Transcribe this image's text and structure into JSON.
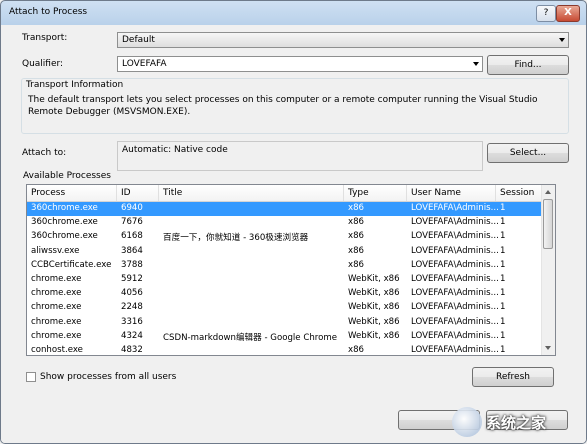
{
  "window": {
    "title": "Attach to Process",
    "help_label": "?",
    "close_label": "X"
  },
  "transport": {
    "label": "Transport:",
    "value": "Default"
  },
  "qualifier": {
    "label": "Qualifier:",
    "value": "LOVEFAFA",
    "find_button": "Find..."
  },
  "transport_info": {
    "label": "Transport Information",
    "text": "The default transport lets you select processes on this computer or a remote computer running the Visual Studio Remote Debugger (MSVSMON.EXE)."
  },
  "attach_to": {
    "label": "Attach to:",
    "value": "Automatic: Native code",
    "select_button": "Select..."
  },
  "available": {
    "label": "Available Processes",
    "columns": [
      "Process",
      "ID",
      "Title",
      "Type",
      "User Name",
      "Session"
    ],
    "rows": [
      {
        "process": "360chrome.exe",
        "id": "6940",
        "title": "",
        "type": "x86",
        "user": "LOVEFAFA\\Adminis...",
        "session": "1"
      },
      {
        "process": "360chrome.exe",
        "id": "7676",
        "title": "",
        "type": "x86",
        "user": "LOVEFAFA\\Adminis...",
        "session": "1"
      },
      {
        "process": "360chrome.exe",
        "id": "6168",
        "title": "百度一下，你就知道 - 360极速浏览器",
        "type": "x86",
        "user": "LOVEFAFA\\Adminis...",
        "session": "1"
      },
      {
        "process": "aliwssv.exe",
        "id": "3864",
        "title": "",
        "type": "x86",
        "user": "LOVEFAFA\\Adminis...",
        "session": "1"
      },
      {
        "process": "CCBCertificate.exe",
        "id": "3788",
        "title": "",
        "type": "x86",
        "user": "LOVEFAFA\\Adminis...",
        "session": "1"
      },
      {
        "process": "chrome.exe",
        "id": "5912",
        "title": "",
        "type": "WebKit, x86",
        "user": "LOVEFAFA\\Adminis...",
        "session": "1"
      },
      {
        "process": "chrome.exe",
        "id": "4056",
        "title": "",
        "type": "WebKit, x86",
        "user": "LOVEFAFA\\Adminis...",
        "session": "1"
      },
      {
        "process": "chrome.exe",
        "id": "2248",
        "title": "",
        "type": "WebKit, x86",
        "user": "LOVEFAFA\\Adminis...",
        "session": "1"
      },
      {
        "process": "chrome.exe",
        "id": "3316",
        "title": "",
        "type": "WebKit, x86",
        "user": "LOVEFAFA\\Adminis...",
        "session": "1"
      },
      {
        "process": "chrome.exe",
        "id": "4324",
        "title": "CSDN-markdown编辑器 - Google Chrome",
        "type": "WebKit, x86",
        "user": "LOVEFAFA\\Adminis...",
        "session": "1"
      },
      {
        "process": "conhost.exe",
        "id": "4832",
        "title": "",
        "type": "x86",
        "user": "LOVEFAFA\\Adminis...",
        "session": "1"
      }
    ]
  },
  "show_all_users": {
    "label": "Show processes from all users",
    "checked": false
  },
  "refresh_button": "Refresh",
  "watermark_text": "系统之家"
}
